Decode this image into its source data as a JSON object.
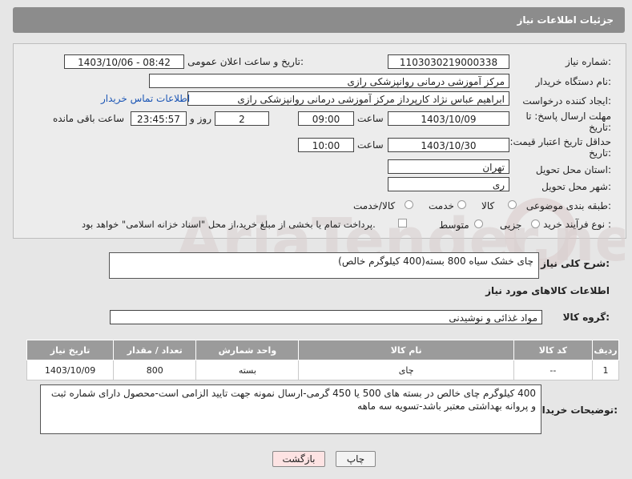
{
  "header": {
    "title": "جزئیات اطلاعات نیاز"
  },
  "form": {
    "need_number_label": "شماره نیاز:",
    "need_number": "1103030219000338",
    "announce_label": "تاریخ و ساعت اعلان عمومی:",
    "announce_value": "1403/10/06 - 08:42",
    "buyer_org_label": "نام دستگاه خریدار:",
    "buyer_org": "مرکز آموزشی درمانی روانپزشکی رازی",
    "creator_label": "ایجاد کننده درخواست:",
    "creator": "ابراهیم عباس نژاد کارپرداز مرکز آموزشی درمانی روانپزشکی رازی",
    "contact_link": "اطلاعات تماس خریدار",
    "deadline_label": "مهلت ارسال پاسخ: تا تاریخ:",
    "deadline_date": "1403/10/09",
    "time_label": "ساعت",
    "deadline_time": "09:00",
    "days_value": "2",
    "days_and_label": "روز و",
    "remaining_time": "23:45:57",
    "remaining_label": "ساعت باقی مانده",
    "validity_label": "حداقل تاریخ اعتبار قیمت: تا تاریخ:",
    "validity_date": "1403/10/30",
    "validity_time": "10:00",
    "province_label": "استان محل تحویل:",
    "province": "تهران",
    "city_label": "شهر محل تحویل:",
    "city": "ری",
    "category_label": "طبقه بندی موضوعی:",
    "category_options": [
      "کالا",
      "خدمت",
      "کالا/خدمت"
    ],
    "process_label": "نوع فرآیند خرید :",
    "process_options": [
      "جزیی",
      "متوسط"
    ],
    "payment_note": "پرداخت تمام یا بخشی از مبلغ خرید،از محل \"اسناد خزانه اسلامی\" خواهد بود."
  },
  "summary": {
    "label": "شرح کلی نیاز:",
    "value": "چای خشک سیاه 800 بسته(400 کیلوگرم خالص)"
  },
  "goods_section_title": "اطلاعات کالاهای مورد نیاز",
  "goods_group": {
    "label": "گروه کالا:",
    "value": "مواد غذائی و نوشیدنی"
  },
  "table": {
    "headers": [
      "ردیف",
      "کد کالا",
      "نام کالا",
      "واحد شمارش",
      "تعداد / مقدار",
      "تاریخ نیاز"
    ],
    "rows": [
      {
        "row": "1",
        "code": "--",
        "name": "چای",
        "unit": "بسته",
        "qty": "800",
        "date": "1403/10/09"
      }
    ]
  },
  "buyer_notes": {
    "label": "توضیحات خریدار:",
    "value": "400 کیلوگرم چای خالص در بسته های 500 یا 450 گرمی-ارسال نمونه جهت تایید الزامی است-محصول دارای شماره ثبت و پروانه بهداشتی معتبر باشد-تسویه سه ماهه"
  },
  "buttons": {
    "print": "چاپ",
    "back": "بازگشت"
  },
  "watermark": "AriaTender.net",
  "colors": {
    "header_bg": "#8c8c8c",
    "link": "#1a55b5",
    "back_button_bg": "#fde3e3"
  }
}
